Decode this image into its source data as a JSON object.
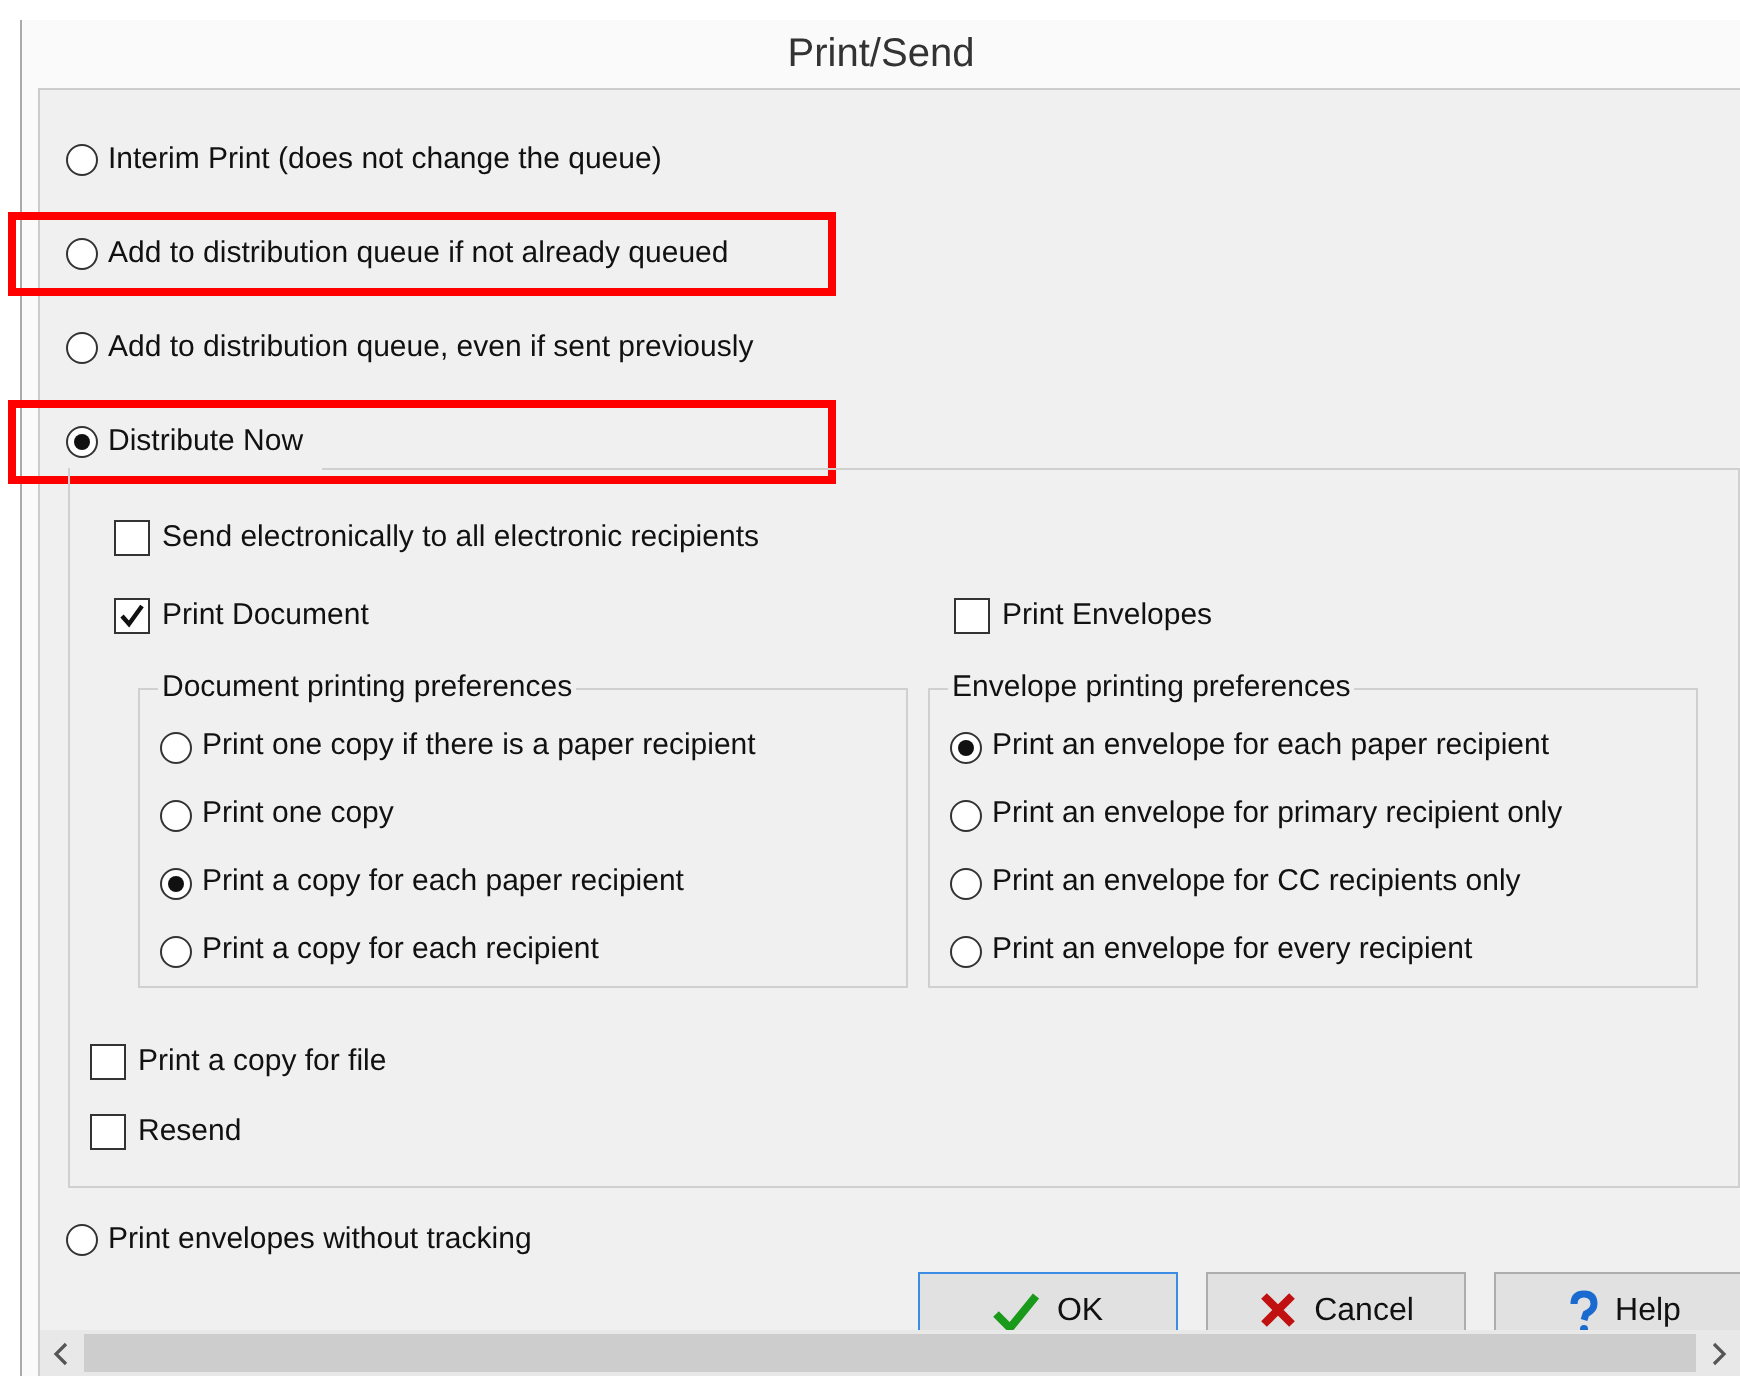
{
  "window": {
    "title": "Print/Send"
  },
  "modes": [
    {
      "label": "Interim Print (does not change the queue)",
      "selected": false,
      "highlighted": false
    },
    {
      "label": "Add to distribution queue if not already queued",
      "selected": false,
      "highlighted": true
    },
    {
      "label": "Add to distribution queue, even if sent previously",
      "selected": false,
      "highlighted": false
    },
    {
      "label": "Distribute Now",
      "selected": true,
      "highlighted": true
    }
  ],
  "distribute": {
    "send_electronically": {
      "label": "Send electronically to all electronic recipients",
      "checked": false
    },
    "print_document": {
      "label": "Print Document",
      "checked": true
    },
    "print_envelopes": {
      "label": "Print Envelopes",
      "checked": false
    },
    "document_preferences": {
      "title": "Document printing preferences",
      "options": [
        {
          "label": "Print one copy if there is a paper recipient",
          "selected": false
        },
        {
          "label": "Print one copy",
          "selected": false
        },
        {
          "label": "Print a copy for each paper recipient",
          "selected": true
        },
        {
          "label": "Print a copy for each recipient",
          "selected": false
        }
      ]
    },
    "envelope_preferences": {
      "title": "Envelope printing preferences",
      "options": [
        {
          "label": "Print an envelope for each paper recipient",
          "selected": true
        },
        {
          "label": "Print an envelope for primary recipient only",
          "selected": false
        },
        {
          "label": "Print an envelope for CC recipients only",
          "selected": false
        },
        {
          "label": "Print an envelope for every recipient",
          "selected": false
        }
      ]
    },
    "print_copy_for_file": {
      "label": "Print a copy for file",
      "checked": false
    },
    "resend": {
      "label": "Resend",
      "checked": false
    }
  },
  "print_envelopes_without_tracking": {
    "label": "Print envelopes without tracking",
    "selected": false
  },
  "buttons": [
    {
      "kind": "ok",
      "label": "OK",
      "focused": true
    },
    {
      "kind": "cancel",
      "label": "Cancel",
      "focused": false
    },
    {
      "kind": "help",
      "label": "Help",
      "focused": false
    }
  ]
}
